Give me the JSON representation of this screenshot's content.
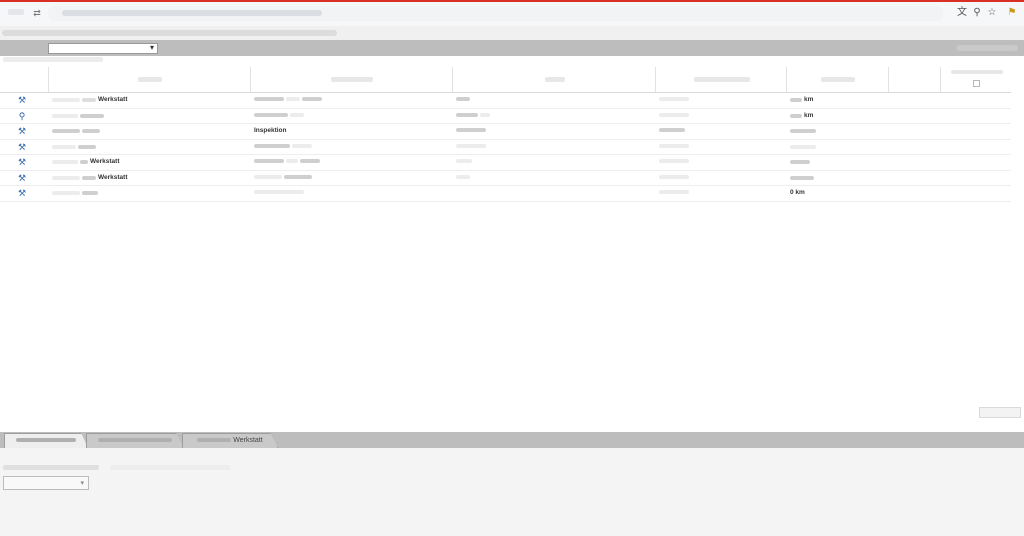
{
  "toolbar": {
    "select_arrow": "▾"
  },
  "grid": {
    "rows": [
      {
        "icon": "⚒",
        "icon_color": "#3a6fb0",
        "col1": "Werkstatt",
        "col2": "",
        "col3": "",
        "col4": "",
        "col5": "km"
      },
      {
        "icon": "⚲",
        "icon_color": "#2a5aa0",
        "col1": "",
        "col2": "",
        "col3": "",
        "col4": "",
        "col5": "km"
      },
      {
        "icon": "⚒",
        "icon_color": "#3a6fb0",
        "col1": "",
        "col2": "Inspektion",
        "col3": "",
        "col4": "",
        "col5": ""
      },
      {
        "icon": "⚒",
        "icon_color": "#3a6fb0",
        "col1": "",
        "col2": "",
        "col3": "",
        "col4": "",
        "col5": ""
      },
      {
        "icon": "⚒",
        "icon_color": "#3a6fb0",
        "col1": "Werkstatt",
        "col2": "",
        "col3": "",
        "col4": "",
        "col5": ""
      },
      {
        "icon": "⚒",
        "icon_color": "#3a6fb0",
        "col1": "Werkstatt",
        "col2": "",
        "col3": "",
        "col4": "",
        "col5": ""
      },
      {
        "icon": "⚒",
        "icon_color": "#3a6fb0",
        "col1": "",
        "col2": "",
        "col3": "",
        "col4": "",
        "col5": "0 km"
      }
    ]
  },
  "bottom_tabs": {
    "tab3_label": "Werkstatt"
  },
  "panel": {
    "field_arrow": "▾"
  }
}
